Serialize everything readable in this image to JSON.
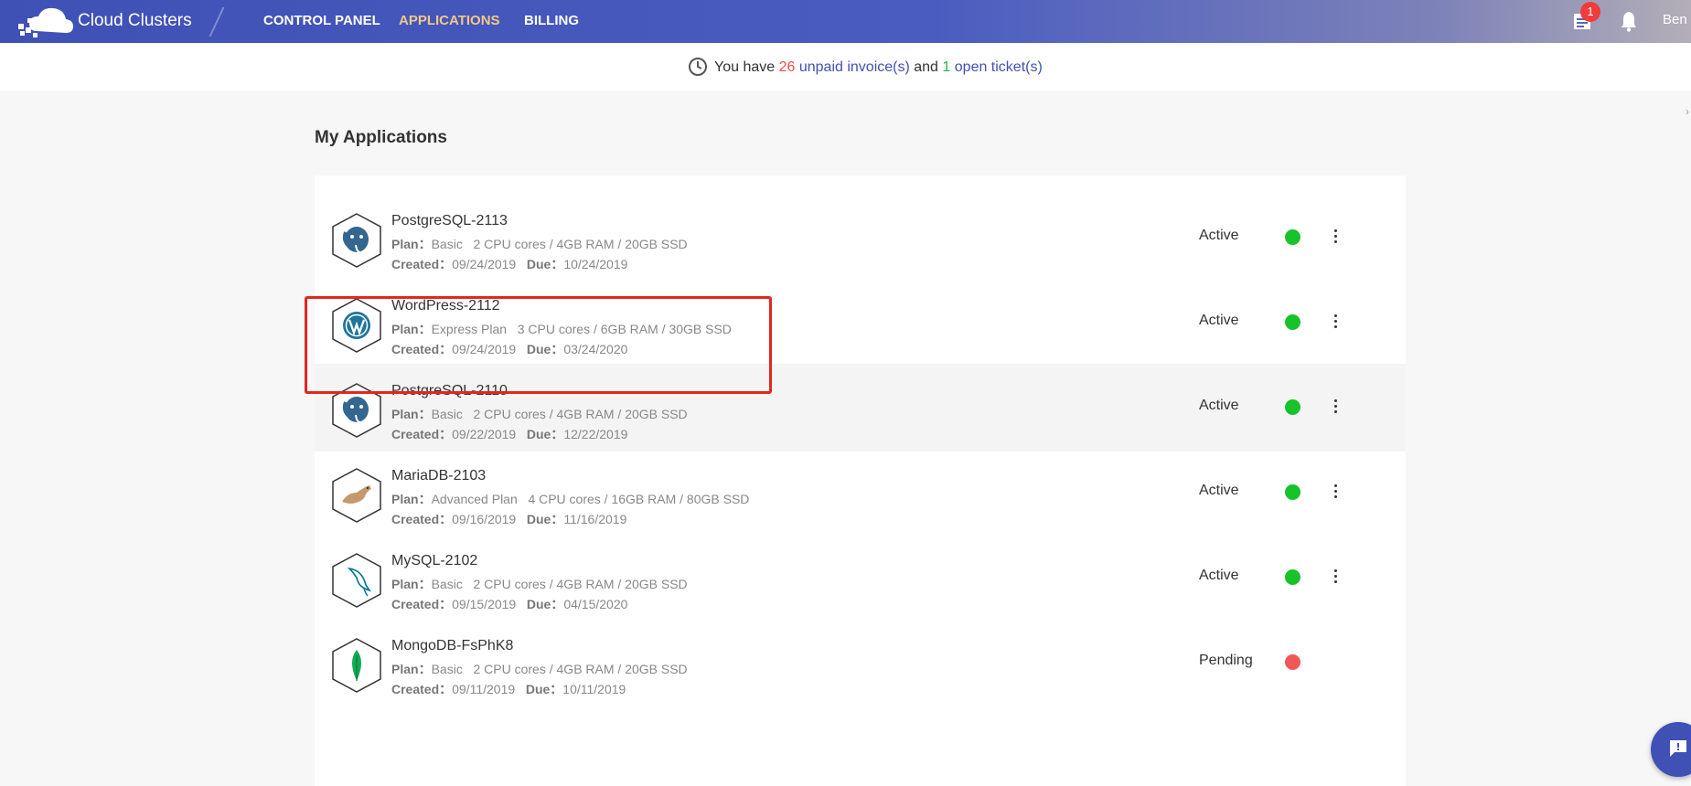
{
  "header": {
    "brand": "Cloud Clusters",
    "nav": [
      "CONTROL PANEL",
      "APPLICATIONS",
      "BILLING"
    ],
    "active_nav": "APPLICATIONS",
    "ticket_badge": "1",
    "user": "Ben"
  },
  "notice": {
    "prefix": "You have",
    "unpaid_count": "26",
    "unpaid_label": "unpaid invoice(s)",
    "and": "and",
    "ticket_count": "1",
    "ticket_label": "open ticket(s)"
  },
  "page_title": "My Applications",
  "labels": {
    "plan": "Plan：",
    "created": "Created：",
    "due": "Due："
  },
  "apps": [
    {
      "name": "PostgreSQL-2113",
      "icon": "postgresql-icon",
      "plan": "Basic",
      "spec": "2 CPU cores / 4GB RAM / 20GB SSD",
      "created": "09/24/2019",
      "due": "10/24/2019",
      "status": "Active"
    },
    {
      "name": "WordPress-2112",
      "icon": "wordpress-icon",
      "plan": "Express Plan",
      "spec": "3 CPU cores / 6GB RAM / 30GB SSD",
      "created": "09/24/2019",
      "due": "03/24/2020",
      "status": "Active"
    },
    {
      "name": "PostgreSQL-2110",
      "icon": "postgresql-icon",
      "plan": "Basic",
      "spec": "2 CPU cores / 4GB RAM / 20GB SSD",
      "created": "09/22/2019",
      "due": "12/22/2019",
      "status": "Active"
    },
    {
      "name": "MariaDB-2103",
      "icon": "mariadb-icon",
      "plan": "Advanced Plan",
      "spec": "4 CPU cores / 16GB RAM / 80GB SSD",
      "created": "09/16/2019",
      "due": "11/16/2019",
      "status": "Active"
    },
    {
      "name": "MySQL-2102",
      "icon": "mysql-icon",
      "plan": "Basic",
      "spec": "2 CPU cores / 4GB RAM / 20GB SSD",
      "created": "09/15/2019",
      "due": "04/15/2020",
      "status": "Active"
    },
    {
      "name": "MongoDB-FsPhK8",
      "icon": "mongodb-icon",
      "plan": "Basic",
      "spec": "2 CPU cores / 4GB RAM / 20GB SSD",
      "created": "09/11/2019",
      "due": "10/11/2019",
      "status": "Pending"
    }
  ],
  "colors": {
    "accent": "#3f51b5",
    "active_nav": "#f0c987",
    "status_active": "#17c22b",
    "status_pending": "#f25656",
    "highlight": "#e4261f"
  }
}
